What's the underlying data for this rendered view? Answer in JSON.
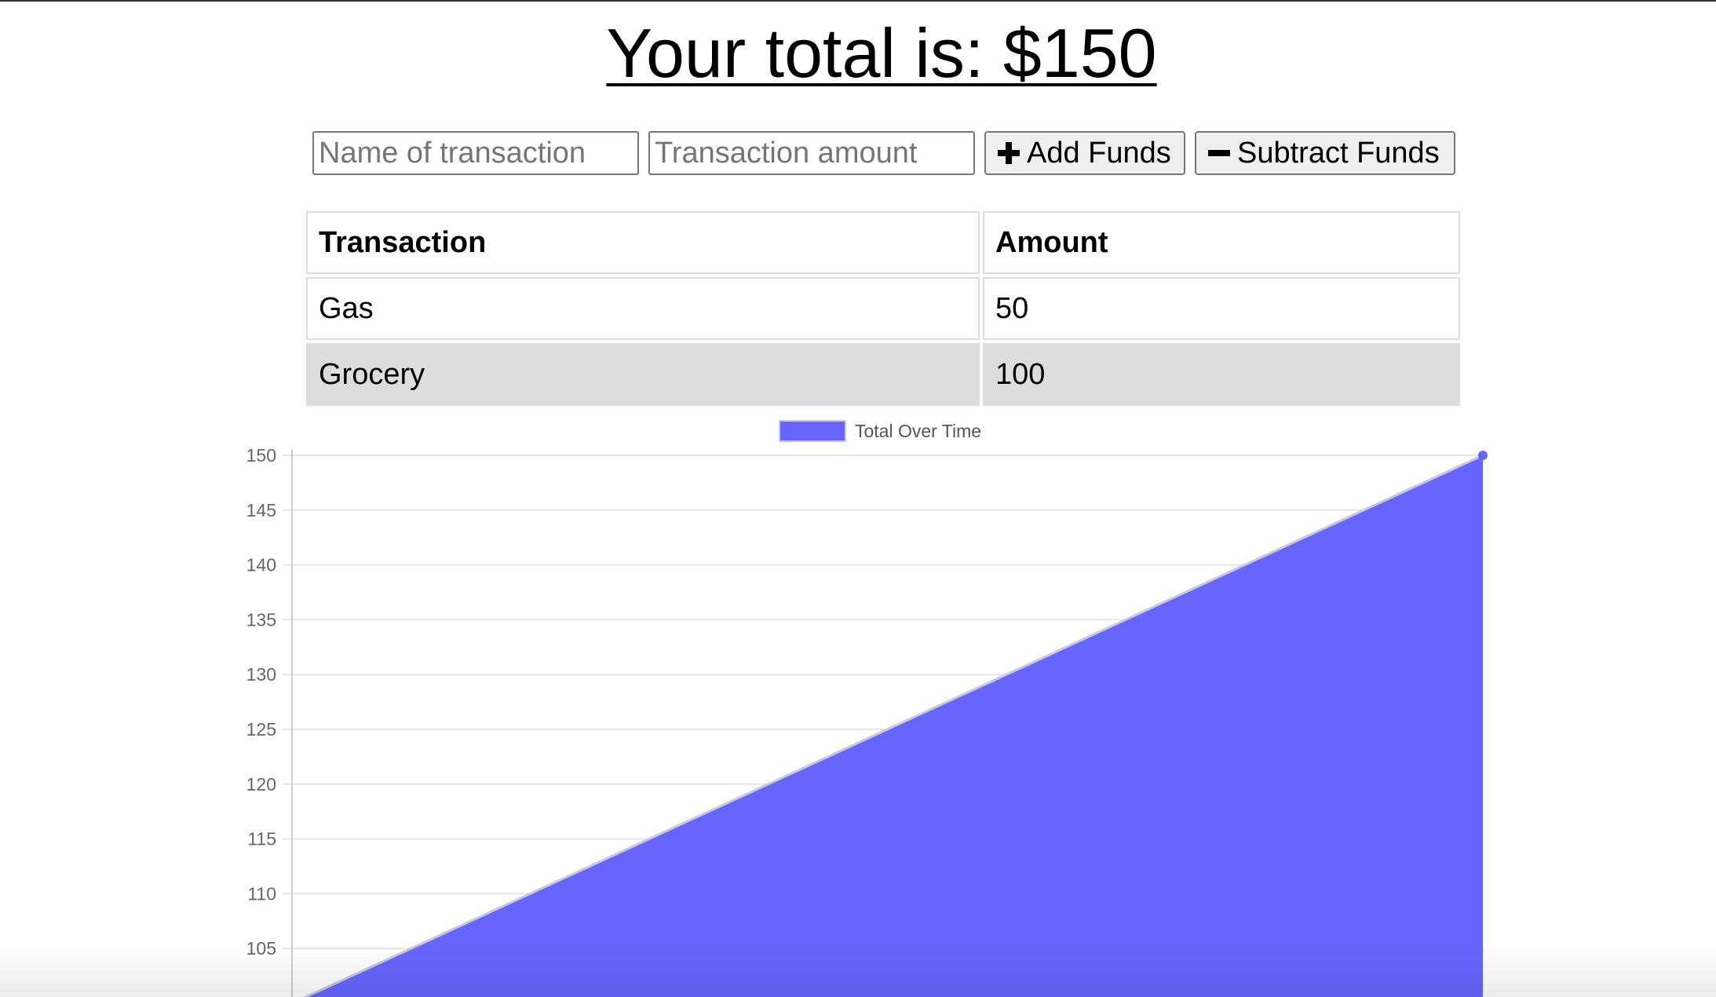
{
  "header": {
    "title": "Your total is: $150"
  },
  "form": {
    "name_placeholder": "Name of transaction",
    "amount_placeholder": "Transaction amount",
    "add_label": "Add Funds",
    "subtract_label": "Subtract Funds",
    "add_icon": "plus-icon",
    "subtract_icon": "minus-icon"
  },
  "table": {
    "headers": [
      "Transaction",
      "Amount"
    ],
    "rows": [
      {
        "name": "Gas",
        "amount": "50"
      },
      {
        "name": "Grocery",
        "amount": "100"
      }
    ]
  },
  "chart_data": {
    "type": "area",
    "series": [
      {
        "name": "Total Over Time",
        "color": "#6666ff",
        "values": [
          100,
          150
        ]
      }
    ],
    "x": [
      0,
      1
    ],
    "ylim": [
      100,
      150
    ],
    "yticks": [
      150,
      145,
      140,
      135,
      130,
      125,
      120,
      115,
      110,
      105
    ],
    "grid": true,
    "legend": "top-center"
  }
}
